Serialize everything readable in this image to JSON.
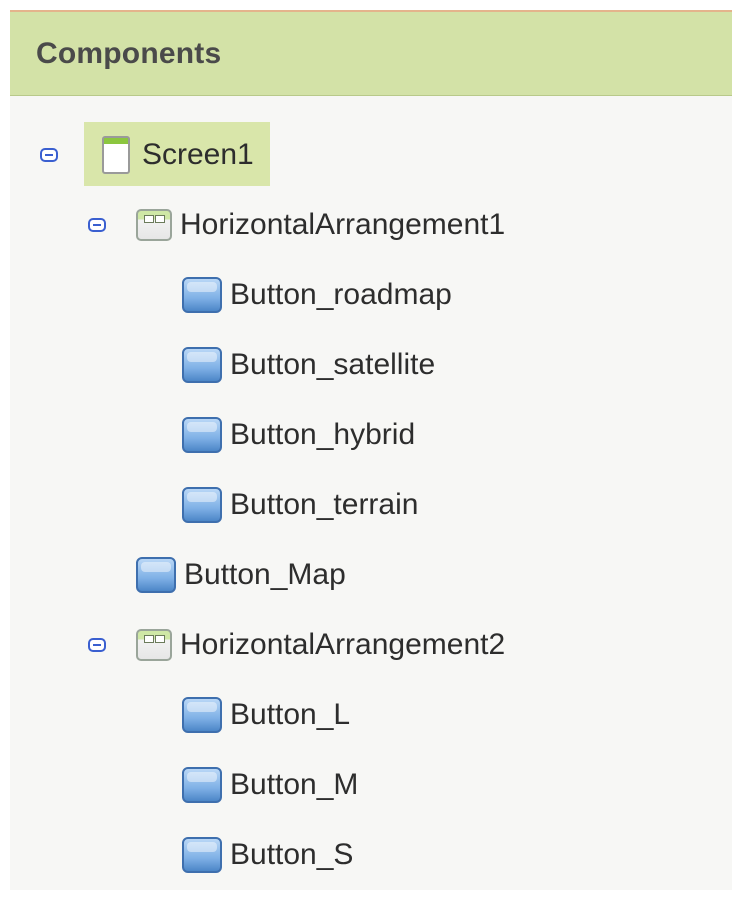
{
  "panel": {
    "title": "Components",
    "header_color": "#d3e2a7",
    "accent_top_border": "#e4b48c"
  },
  "tree": {
    "nodes": [
      {
        "label": "Screen1",
        "icon": "screen-icon",
        "depth": 0,
        "expanded": true,
        "selected": true
      },
      {
        "label": "HorizontalArrangement1",
        "icon": "horizontal-arrangement-icon",
        "depth": 1,
        "expanded": true
      },
      {
        "label": "Button_roadmap",
        "icon": "button-icon",
        "depth": 2
      },
      {
        "label": "Button_satellite",
        "icon": "button-icon",
        "depth": 2
      },
      {
        "label": "Button_hybrid",
        "icon": "button-icon",
        "depth": 2
      },
      {
        "label": "Button_terrain",
        "icon": "button-icon",
        "depth": 2
      },
      {
        "label": "Button_Map",
        "icon": "button-icon",
        "depth": 1
      },
      {
        "label": "HorizontalArrangement2",
        "icon": "horizontal-arrangement-icon",
        "depth": 1,
        "expanded": true
      },
      {
        "label": "Button_L",
        "icon": "button-icon",
        "depth": 2
      },
      {
        "label": "Button_M",
        "icon": "button-icon",
        "depth": 2
      },
      {
        "label": "Button_S",
        "icon": "button-icon",
        "depth": 2
      }
    ]
  }
}
